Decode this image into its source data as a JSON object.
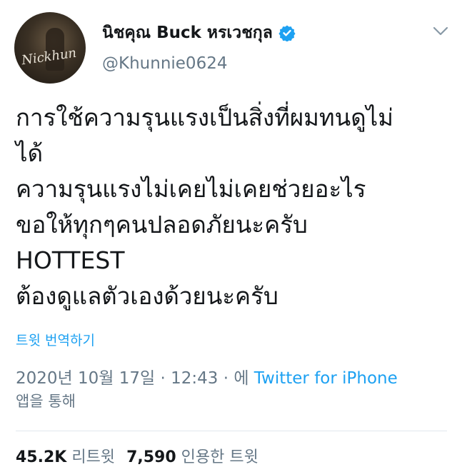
{
  "author": {
    "display_name": "นิชคุณ Buck หรเวชกุล",
    "handle": "@Khunnie0624",
    "verified_icon": "verified-badge-icon",
    "avatar_signature": "Nickhun"
  },
  "tweet": {
    "lines": [
      "การใช้ความรุนแรงเป็นสิ่งที่ผมทนดูไม่",
      "ได้",
      "ความรุนแรงไม่เคยไม่เคยช่วยอะไร",
      "ขอให้ทุกๆคนปลอดภัยนะครับ",
      "HOTTEST",
      "ต้องดูแลตัวเองด้วยนะครับ"
    ],
    "translate_label": "트윗 번역하기"
  },
  "meta": {
    "timestamp": "2020년 10월 17일 · 12:43 · 에",
    "source": "Twitter for iPhone",
    "via_suffix": "앱을 통해"
  },
  "stats": {
    "retweets_count": "45.2K",
    "retweets_label": "리트윗",
    "quotes_count": "7,590",
    "quotes_label": "인용한 트윗"
  },
  "colors": {
    "accent": "#1da1f2",
    "secondary_text": "#657786",
    "primary_text": "#14171a"
  }
}
